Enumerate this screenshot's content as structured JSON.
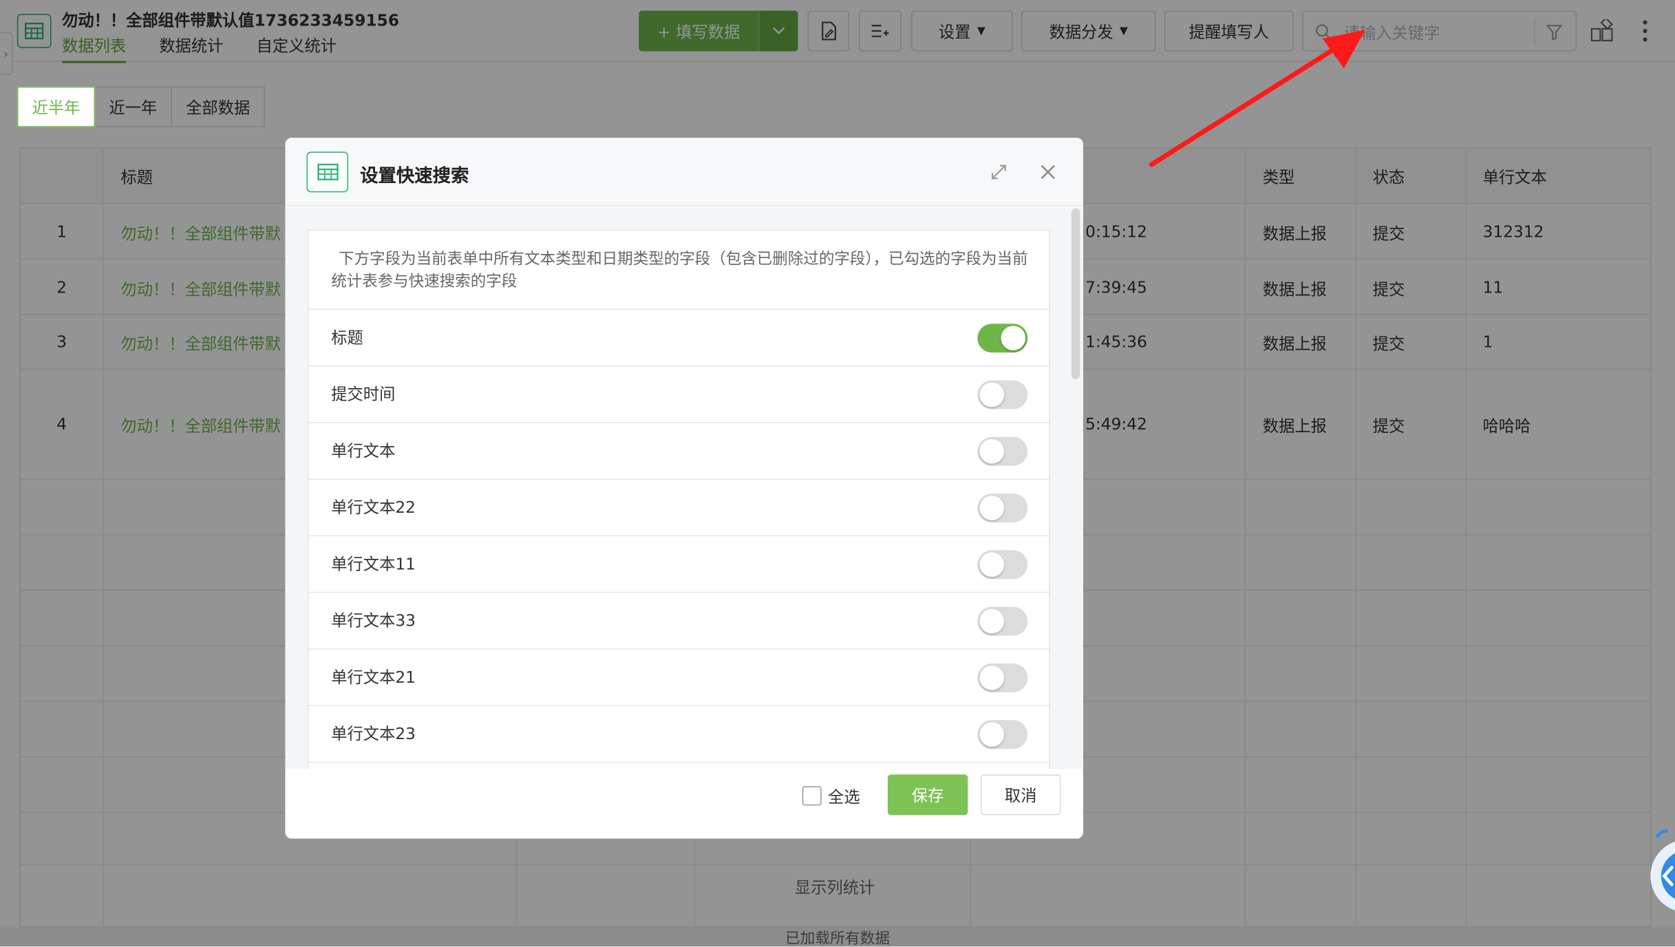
{
  "app": {
    "title": "勿动！！全部组件带默认值1736233459156",
    "tabs": [
      "数据列表",
      "数据统计",
      "自定义统计"
    ]
  },
  "toolbar": {
    "fill_label": "+ 填写数据",
    "settings_label": "设置",
    "distribute_label": "数据分发",
    "remind_label": "提醒填写人",
    "search_placeholder": "请输入关键字"
  },
  "period": {
    "items": [
      "近半年",
      "近一年",
      "全部数据"
    ],
    "active": "近半年"
  },
  "table": {
    "headers": [
      "标题",
      "类型",
      "状态",
      "单行文本"
    ],
    "rows": [
      {
        "no": "1",
        "title": "勿动！！全部组件带默",
        "time": "0:15:12",
        "type": "数据上报",
        "status": "提交",
        "text": "312312"
      },
      {
        "no": "2",
        "title": "勿动！！全部组件带默",
        "time": "7:39:45",
        "type": "数据上报",
        "status": "提交",
        "text": "11"
      },
      {
        "no": "3",
        "title": "勿动！！全部组件带默",
        "time": "1:45:36",
        "type": "数据上报",
        "status": "提交",
        "text": "1"
      },
      {
        "no": "4",
        "title": "勿动！！全部组件带默",
        "time": "5:49:42",
        "type": "数据上报",
        "status": "提交",
        "text": "哈哈哈"
      }
    ],
    "column_stats_label": "显示列统计",
    "loaded_note": "已加载所有数据"
  },
  "dialog": {
    "title": "设置快速搜索",
    "description": "下方字段为当前表单中所有文本类型和日期类型的字段（包含已删除过的字段），已勾选的字段为当前统计表参与快速搜索的字段",
    "fields": [
      {
        "label": "标题",
        "on": true
      },
      {
        "label": "提交时间",
        "on": false
      },
      {
        "label": "单行文本",
        "on": false
      },
      {
        "label": "单行文本22",
        "on": false
      },
      {
        "label": "单行文本11",
        "on": false
      },
      {
        "label": "单行文本33",
        "on": false
      },
      {
        "label": "单行文本21",
        "on": false
      },
      {
        "label": "单行文本23",
        "on": false
      }
    ],
    "select_all_label": "全选",
    "save_label": "保存",
    "cancel_label": "取消"
  },
  "colors": {
    "accent": "#6fb64a",
    "brand_icon": "#2bb573",
    "arrow": "#ff1a1a"
  }
}
